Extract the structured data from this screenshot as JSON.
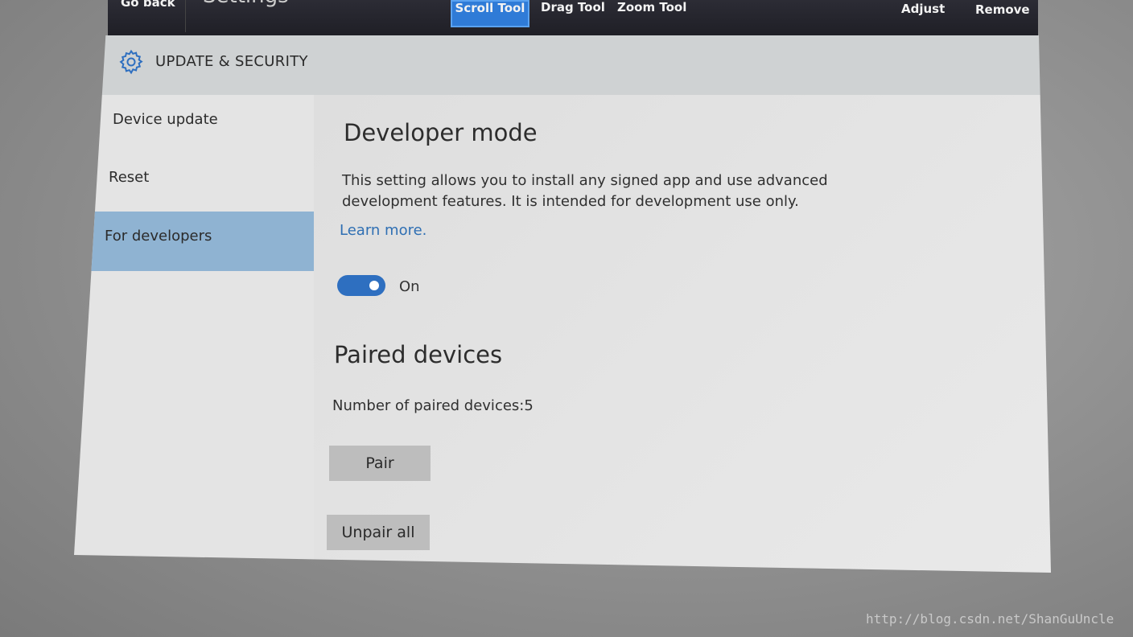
{
  "topbar": {
    "go_back": "Go back",
    "app_title": "Settings",
    "tools": [
      "Scroll Tool",
      "Drag Tool",
      "Zoom Tool"
    ],
    "adjust": "Adjust",
    "remove": "Remove"
  },
  "header": {
    "icon": "gear-icon",
    "title": "UPDATE & SECURITY"
  },
  "sidebar": {
    "items": [
      {
        "label": "Device update"
      },
      {
        "label": "Reset"
      },
      {
        "label": "For developers"
      }
    ]
  },
  "developer_mode": {
    "heading": "Developer mode",
    "description": "This setting allows you to install any signed app and use advanced development features. It is intended for development use only.",
    "learn_more": "Learn more.",
    "toggle_state": "On"
  },
  "paired_devices": {
    "heading": "Paired devices",
    "count_text": "Number of paired devices:5",
    "pair_label": "Pair",
    "unpair_label": "Unpair all"
  },
  "watermark": "http://blog.csdn.net/ShanGuUncle",
  "colors": {
    "accent": "#2e6fc0",
    "selected_nav": "#8fb3d2",
    "link": "#2f6fb3"
  }
}
